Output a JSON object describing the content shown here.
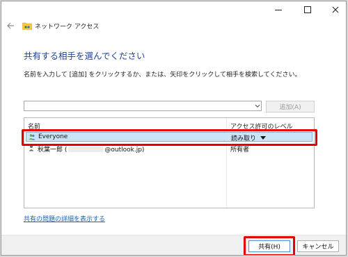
{
  "window": {
    "header_title": "ネットワーク アクセス"
  },
  "main": {
    "heading": "共有する相手を選んでください",
    "instruction": "名前を入力して [追加] をクリックするか、または、矢印をクリックして相手を検索してください。",
    "combo": {
      "value": ""
    },
    "add_button": "追加(A)",
    "table": {
      "columns": [
        "名前",
        "アクセス許可のレベル"
      ],
      "rows": [
        {
          "name": "Everyone",
          "level": "読み取り",
          "icon": "users-group-icon",
          "selected": true
        },
        {
          "name_prefix": "秋葉一郎 (",
          "name_suffix": "@outlook.jp)",
          "level": "所有者",
          "icon": "user-icon",
          "selected": false
        }
      ]
    },
    "details_link": "共有の問題の詳細を表示する"
  },
  "footer": {
    "share_button": "共有(H)",
    "cancel_button": "キャンセル"
  },
  "colors": {
    "heading": "#1f3f9a",
    "link": "#1a5fb4",
    "selection": "#cce4f7",
    "highlight": "#e50000"
  }
}
